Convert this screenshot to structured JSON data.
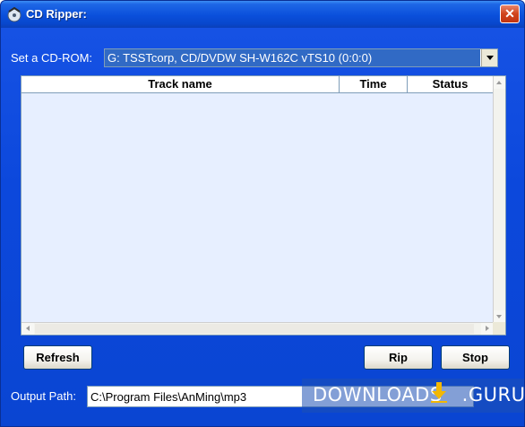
{
  "window": {
    "title": "CD Ripper:",
    "icon": "cd-ripper-app-icon",
    "close_icon": "close-icon"
  },
  "cdrom": {
    "label": "Set a CD-ROM:",
    "selected": "G: TSSTcorp, CD/DVDW SH-W162C vTS10 (0:0:0)"
  },
  "tracklist": {
    "columns": [
      "Track name",
      "Time",
      "Status"
    ],
    "rows": []
  },
  "buttons": {
    "refresh": "Refresh",
    "rip": "Rip",
    "stop": "Stop"
  },
  "output": {
    "label": "Output Path:",
    "value": "C:\\Program Files\\AnMing\\mp3"
  },
  "watermark": {
    "text_left": "DOWNLOADS",
    "text_right": ".GURU",
    "accent_color": "#f2b705"
  }
}
